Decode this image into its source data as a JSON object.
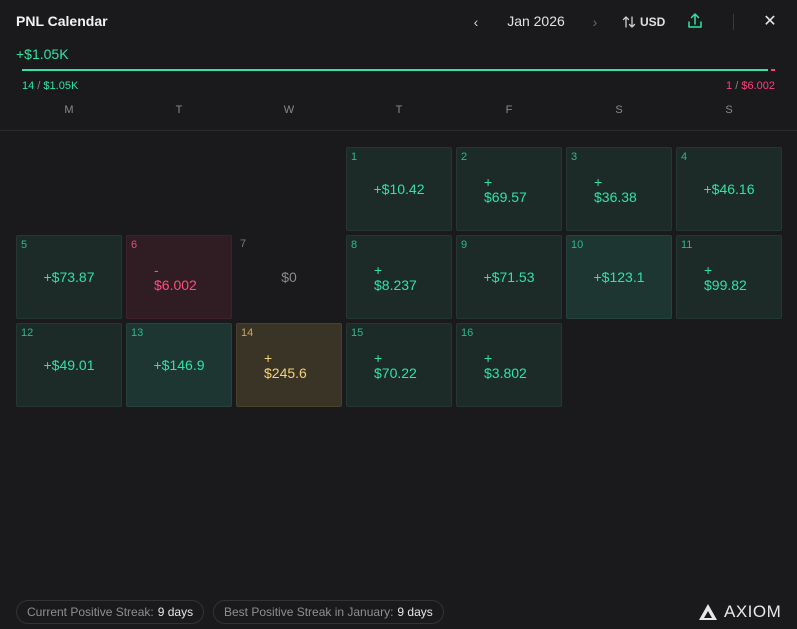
{
  "header": {
    "title": "PNL Calendar",
    "month": "Jan 2026",
    "prev_glyph": "‹",
    "next_glyph": "›",
    "currency": "USD",
    "currency_icon": "swap-vertical-icon",
    "share_icon": "share-upload-icon",
    "close_glyph": "✕"
  },
  "summary": {
    "total": "+$1.05K",
    "win_days": "14",
    "win_amount": "$1.05K",
    "loss_days": "1",
    "loss_amount": "$6.002",
    "slash": " / ",
    "colors": {
      "positive": "#2fe3a3",
      "negative": "#ff3f7a",
      "best": "#f5d27a"
    }
  },
  "weekdays": [
    "M",
    "T",
    "W",
    "T",
    "F",
    "S",
    "S"
  ],
  "days": [
    {
      "day": "1",
      "sign": "",
      "amount": "+$10.42",
      "kind": "pos"
    },
    {
      "day": "2",
      "sign": "+",
      "amount": "$69.57",
      "kind": "pos"
    },
    {
      "day": "3",
      "sign": "+",
      "amount": "$36.38",
      "kind": "pos"
    },
    {
      "day": "4",
      "sign": "",
      "amount": "+$46.16",
      "kind": "pos"
    },
    {
      "day": "5",
      "sign": "",
      "amount": "+$73.87",
      "kind": "pos"
    },
    {
      "day": "6",
      "sign": "-",
      "amount": "$6.002",
      "kind": "neg"
    },
    {
      "day": "7",
      "sign": "",
      "amount": "$0",
      "kind": "zero"
    },
    {
      "day": "8",
      "sign": "+",
      "amount": "$8.237",
      "kind": "pos"
    },
    {
      "day": "9",
      "sign": "",
      "amount": "+$71.53",
      "kind": "pos"
    },
    {
      "day": "10",
      "sign": "",
      "amount": "+$123.1",
      "kind": "pos-hi"
    },
    {
      "day": "11",
      "sign": "+",
      "amount": "$99.82",
      "kind": "pos"
    },
    {
      "day": "12",
      "sign": "",
      "amount": "+$49.01",
      "kind": "pos"
    },
    {
      "day": "13",
      "sign": "",
      "amount": "+$146.9",
      "kind": "pos-hi"
    },
    {
      "day": "14",
      "sign": "+",
      "amount": "$245.6",
      "kind": "best"
    },
    {
      "day": "15",
      "sign": "+",
      "amount": "$70.22",
      "kind": "pos"
    },
    {
      "day": "16",
      "sign": "+",
      "amount": "$3.802",
      "kind": "pos"
    }
  ],
  "footer": {
    "current_streak_label": "Current Positive Streak:",
    "current_streak_value": "9 days",
    "best_streak_label": "Best Positive Streak in January:",
    "best_streak_value": "9 days",
    "brand": "AXIOM",
    "brand_icon": "axiom-logo-icon"
  }
}
